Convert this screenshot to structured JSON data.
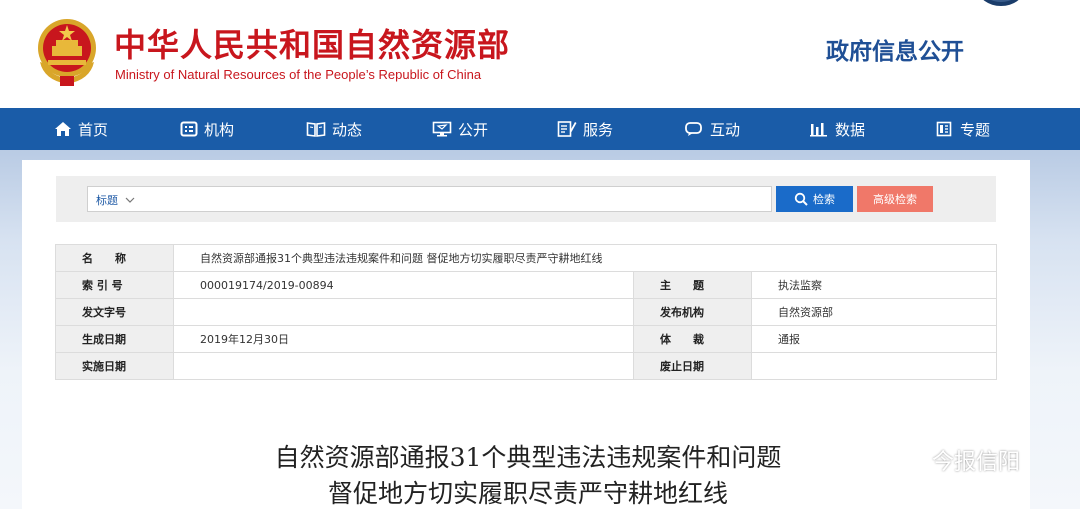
{
  "header": {
    "title_cn": "中华人民共和国自然资源部",
    "title_en": "Ministry of Natural Resources of the People’s Republic of China",
    "gov_info": "政府信息公开"
  },
  "nav": [
    {
      "label": "首页",
      "icon": "home-icon"
    },
    {
      "label": "机构",
      "icon": "org-icon"
    },
    {
      "label": "动态",
      "icon": "book-icon"
    },
    {
      "label": "公开",
      "icon": "monitor-icon"
    },
    {
      "label": "服务",
      "icon": "edit-icon"
    },
    {
      "label": "互动",
      "icon": "chat-icon"
    },
    {
      "label": "数据",
      "icon": "bar-chart-icon"
    },
    {
      "label": "专题",
      "icon": "document-icon"
    }
  ],
  "search": {
    "type_label": "标题",
    "search_button": "检索",
    "advanced_button": "高级检索"
  },
  "info": {
    "name_label": "名　　称",
    "name_value": "自然资源部通报31个典型违法违规案件和问题 督促地方切实履职尽责严守耕地红线",
    "index_label": "索 引 号",
    "index_value": "000019174/2019-00894",
    "topic_label": "主　　题",
    "topic_value": "执法监察",
    "doc_no_label": "发文字号",
    "doc_no_value": "",
    "publisher_label": "发布机构",
    "publisher_value": "自然资源部",
    "created_label": "生成日期",
    "created_value": "2019年12月30日",
    "genre_label": "体　　裁",
    "genre_value": "通报",
    "effective_label": "实施日期",
    "effective_value": "",
    "expiry_label": "废止日期",
    "expiry_value": ""
  },
  "article": {
    "title_line1": "自然资源部通报31个典型违法违规案件和问题",
    "title_line2": "督促地方切实履职尽责严守耕地红线"
  },
  "watermark": {
    "text": "今报信阳"
  },
  "colors": {
    "brand_red": "#c8161d",
    "nav_blue": "#1a5ca8",
    "search_blue": "#1a6bc9",
    "advanced_red": "#f07869",
    "gov_info_blue": "#1f4f95"
  }
}
